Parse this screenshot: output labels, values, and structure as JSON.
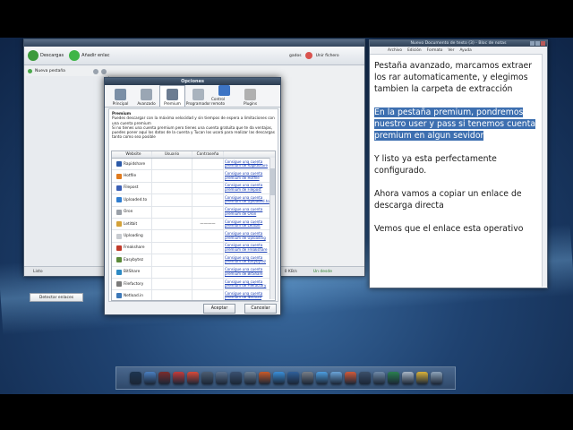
{
  "app": {
    "toolbar": {
      "downloads_label": "Descargas",
      "add_links_label": "Añadir enlac",
      "mid_label": "gados",
      "open_file_label": "Unir fichero"
    },
    "tab_label": "Nueva pestaña",
    "detect_links_button": "Detectar enlaces",
    "status_left": "Listo",
    "status_speed": "0 KB/s",
    "status_clipboard": "Un desde"
  },
  "dialog": {
    "title": "Opciones",
    "tabs": [
      {
        "label": "Principal",
        "color": "#7b8fa6"
      },
      {
        "label": "Avanzado",
        "color": "#9aa6b4"
      },
      {
        "label": "Premium",
        "color": "#6c7d92"
      },
      {
        "label": "Programador",
        "color": "#a9b3be"
      },
      {
        "label": "Control remoto",
        "color": "#3d74c4"
      },
      {
        "label": "Plugins",
        "color": "#b0b0b0"
      }
    ],
    "section_title": "Premium",
    "para1": "Puedes descargar con la máxima velocidad y sin tiempos de espera a limitaciones con una cuenta premium",
    "para2": "Si no tienes una cuenta premium pero tienes una cuenta gratuita que te da ventajas, puedes poner aquí los datos de la cuenta y Tucan los usará para realizar las descargas tanto como sea posible",
    "grid": {
      "headers": [
        "Website",
        "Usuario",
        "Contraseña",
        ""
      ],
      "rows": [
        {
          "site": "Rapidshare",
          "password": "",
          "link": "Consigue una cuenta premium de Rapidshare",
          "color": "#2c5aa8"
        },
        {
          "site": "Hotfile",
          "password": "",
          "link": "Consigue una cuenta premium de Hotfile",
          "color": "#e07b1f"
        },
        {
          "site": "Filepost",
          "password": "",
          "link": "Consigue una cuenta premium de Filepost",
          "color": "#3b5fb5"
        },
        {
          "site": "Uploaded.to",
          "password": "",
          "link": "Consigue una cuenta premium de Uploaded.to",
          "color": "#2f7dd0"
        },
        {
          "site": "Oron",
          "password": "",
          "link": "Consigue una cuenta premium de Oron",
          "color": "#9aa0a8"
        },
        {
          "site": "Letitbit",
          "password": "————",
          "link": "Consigue una cuenta premium de Letitbit",
          "color": "#d4a23a"
        },
        {
          "site": "Uploading",
          "password": "",
          "link": "Consigue una cuenta premium de Uploading",
          "color": "#c7cbd0"
        },
        {
          "site": "Freakshare",
          "password": "",
          "link": "Consigue una cuenta premium de Freakshare",
          "color": "#c03a2b"
        },
        {
          "site": "Easybytez",
          "password": "",
          "link": "Consigue una cuenta premium de Easybytez",
          "color": "#5b8a3a"
        },
        {
          "site": "BitShare",
          "password": "",
          "link": "Consigue una cuenta premium de BitShare",
          "color": "#2d8ac4"
        },
        {
          "site": "Filefactory",
          "password": "",
          "link": "Consigue una cuenta premium de Filefactory",
          "color": "#7a7a7a"
        },
        {
          "site": "Netload.in",
          "password": "",
          "link": "Consigue una cuenta premium de Netload",
          "color": "#3c78b8"
        }
      ]
    },
    "accept_button": "Aceptar",
    "cancel_button": "Cancelar"
  },
  "notepad": {
    "title": "Nuevo Documento de texto (3) - Bloc de notas",
    "menu": [
      "Archivo",
      "Edición",
      "Formato",
      "Ver",
      "Ayuda"
    ],
    "para1": "Pestaña avanzado, marcamos extraer los rar automaticamente, y elegimos tambien la carpeta de extracción",
    "para2": "En la pestaña premium, pondremos nuestro user y pass si tenemos cuenta premium en algun sevidor",
    "para3": "Y listo ya esta perfectamente configurado.",
    "para4": "Ahora vamos a copiar un enlace de descarga directa",
    "para5": "Vemos que el enlace esta operativo"
  },
  "dock": {
    "icons": [
      "#1d3550",
      "#4a7fc1",
      "#7a2d2d",
      "#c23c3c",
      "#d74a3a",
      "#4c5d72",
      "#5d7390",
      "#3a5070",
      "#6b7f95",
      "#c85a2a",
      "#3a8ed8",
      "#2f5f99",
      "#777e88",
      "#4d9ee0",
      "#6aa4d8",
      "#d05a3a",
      "#3b4f6a",
      "#6f8aa8",
      "#2a7f4f",
      "#a8b6c6",
      "#d9b23c",
      "#8da3ba"
    ],
    "names": [
      "finder-dock-icon",
      "calendar-dock-icon",
      "app-dock-icon-3",
      "red-app-dock-icon",
      "media-dock-icon",
      "folder-dock-icon",
      "folder2-dock-icon",
      "game-dock-icon",
      "settings-dock-icon",
      "firefox-dock-icon",
      "chrome-dock-icon",
      "network-dock-icon",
      "tool-dock-icon",
      "messenger-dock-icon",
      "skype-dock-icon",
      "photos-dock-icon",
      "terminal-dock-icon",
      "system-dock-icon",
      "utility-dock-icon",
      "store-dock-icon",
      "lock-dock-icon",
      "trash-dock-icon"
    ]
  }
}
